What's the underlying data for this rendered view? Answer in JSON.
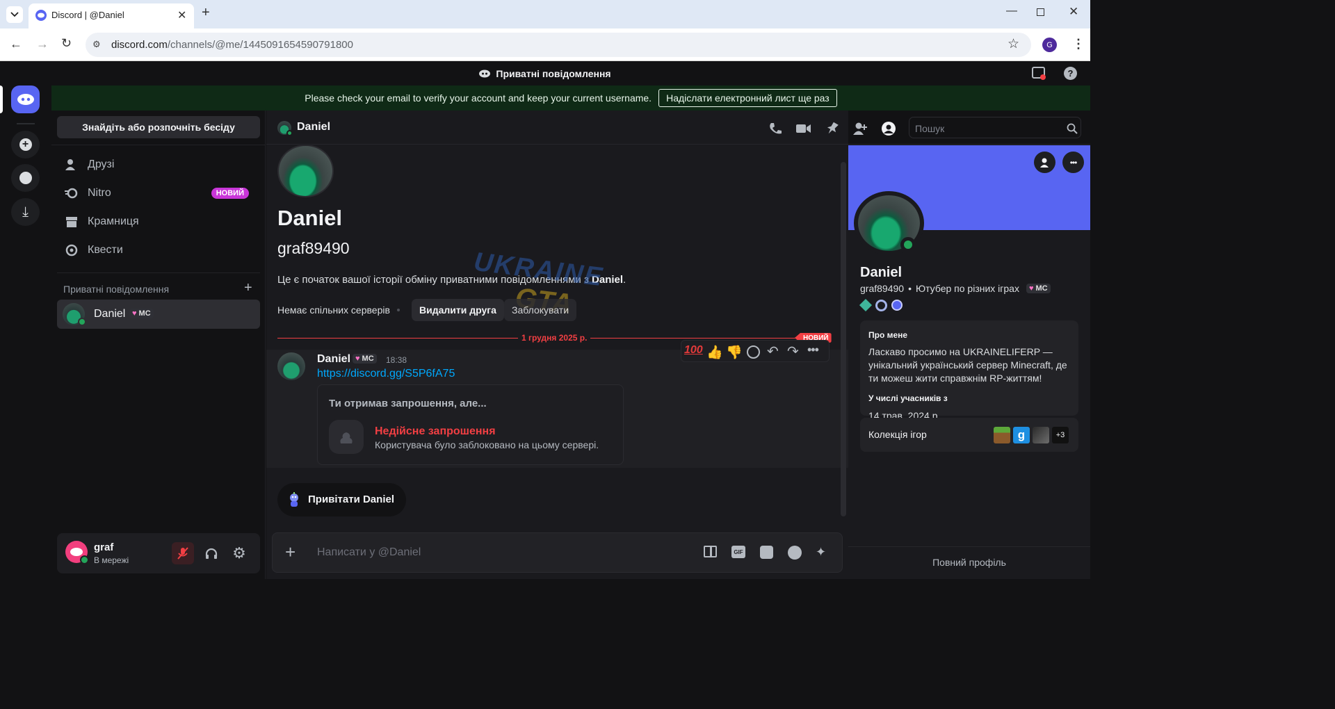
{
  "browser": {
    "tab_title": "Discord | @Daniel",
    "url_host": "discord.com",
    "url_path": "/channels/@me/1445091654590791800",
    "profile_letter": "G"
  },
  "app": {
    "top_title": "Приватні повідомлення",
    "notice_text": "Please check your email to verify your account and keep your current username.",
    "notice_button": "Надіслати електронний лист ще раз"
  },
  "sidebar": {
    "search_button": "Знайдіть або розпочніть бесіду",
    "nav": [
      {
        "label": "Друзі",
        "icon": "friends-icon"
      },
      {
        "label": "Nitro",
        "icon": "nitro-icon",
        "badge": "НОВИЙ"
      },
      {
        "label": "Крамниця",
        "icon": "shop-icon"
      },
      {
        "label": "Квести",
        "icon": "quests-icon"
      }
    ],
    "dm_header": "Приватні повідомлення",
    "dm_item": {
      "name": "Daniel",
      "tag": "MC"
    },
    "user": {
      "name": "graf",
      "status": "В мережі"
    }
  },
  "chat": {
    "header_name": "Daniel",
    "search_placeholder": "Пошук",
    "intro_name": "Daniel",
    "intro_username": "graf89490",
    "intro_text_pre": "Це є початок вашої історії обміну приватними повідомленнями з ",
    "intro_text_name": "Daniel",
    "intro_text_post": ".",
    "no_servers": "Немає спільних серверів",
    "remove_friend": "Видалити друга",
    "block": "Заблокувати",
    "date_divider": "1 грудня 2025 р.",
    "new_label": "НОВИЙ",
    "message": {
      "author": "Daniel",
      "tag": "MC",
      "time": "18:38",
      "link": "https://discord.gg/S5P6fA75",
      "invite_title": "Ти отримав запрошення, але...",
      "invite_error": "Недійсне запрошення",
      "invite_desc": "Користувача було заблоковано на цьому сервері."
    },
    "wave_button": "Привітати Daniel",
    "composer_placeholder": "Написати у @Daniel",
    "watermark_top": "UKRAINE",
    "watermark_bottom": "GTA"
  },
  "profile": {
    "name": "Daniel",
    "username": "graf89490",
    "bio_short": "Ютубер по різних іграх",
    "tag": "MC",
    "about_title": "Про мене",
    "about_text": "Ласкаво просимо на UKRAINELIFERP — унікальний український сервер Minecraft, де ти можеш жити справжнім RP-життям!",
    "member_since_title": "У числі учасників з",
    "member_since": "14 трав. 2024 р.",
    "games_title": "Колекція ігор",
    "games_more": "+3",
    "full_profile": "Повний профіль"
  },
  "colors": {
    "banner": "#5865f2",
    "online": "#23a55a",
    "danger": "#f23f43",
    "link": "#00a8fc",
    "nitro_badge": "#c936d9"
  }
}
